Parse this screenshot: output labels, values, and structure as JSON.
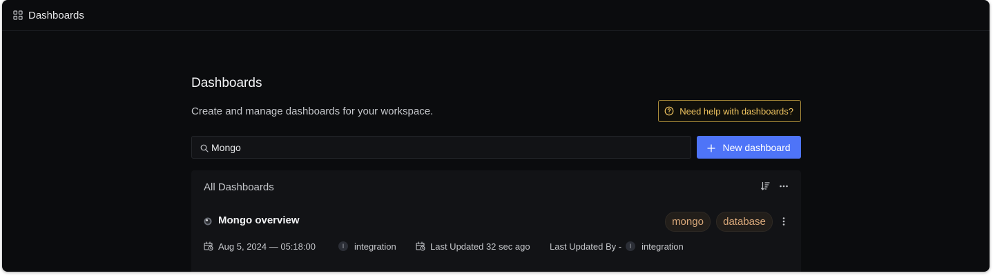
{
  "topbar": {
    "icon": "grid-icon",
    "title": "Dashboards"
  },
  "header": {
    "title": "Dashboards",
    "subtitle": "Create and manage dashboards for your workspace.",
    "help_button": {
      "icon": "help-circle-icon",
      "label": "Need help with dashboards?"
    }
  },
  "search": {
    "icon": "search-icon",
    "value": "Mongo"
  },
  "new_button": {
    "icon": "plus-icon",
    "label": "New dashboard"
  },
  "panel": {
    "title": "All Dashboards",
    "icons": [
      "sort-descending-icon",
      "more-horizontal-icon"
    ],
    "rows": [
      {
        "icon": "mongo-icon",
        "title": "Mongo overview",
        "tags": [
          "mongo",
          "database"
        ],
        "created": "Aug 5, 2024 — 05:18:00",
        "created_by_initial": "I",
        "created_by": "integration",
        "last_updated": "Last Updated 32 sec ago",
        "last_updated_by_label": "Last Updated By -",
        "last_updated_by_initial": "I",
        "last_updated_by": "integration"
      }
    ]
  },
  "colors": {
    "background": "#0b0c0e",
    "panel": "#121316",
    "primary": "#4e74f8",
    "help_accent": "#f1c560",
    "tag_text": "#d9a87a"
  }
}
